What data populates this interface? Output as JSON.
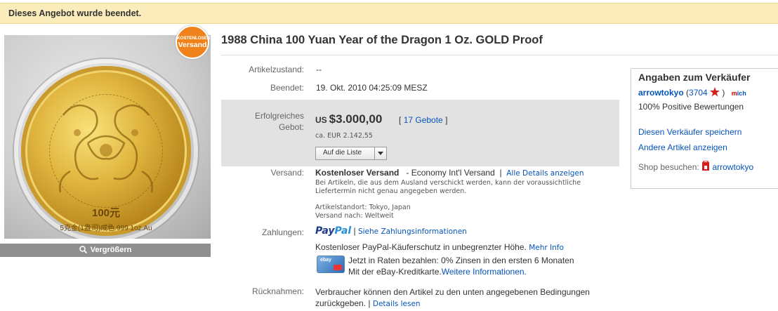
{
  "banner": "Dieses Angebot wurde beendet.",
  "badge": {
    "line1": "KOSTENLOSER",
    "line2": "Versand"
  },
  "coin": {
    "value": "100元",
    "rim": "5克金(1盎司)成色.999 1oz.Au"
  },
  "enlarge_label": "Vergrößern",
  "title": "1988 China 100 Yuan Year of the Dragon 1 Oz. GOLD Proof",
  "condition": {
    "label": "Artikelzustand:",
    "value": "--"
  },
  "ended": {
    "label": "Beendet:",
    "value": "19. Okt. 2010 04:25:09 MESZ"
  },
  "bid": {
    "label_line1": "Erfolgreiches",
    "label_line2": "Gebot:",
    "currency": "US",
    "amount": "$3.000,00",
    "bids_open": "[",
    "bids_link": "17 Gebote",
    "bids_close": "]",
    "converted": "ca. EUR 2.142,55",
    "watch_button": "Auf die Liste"
  },
  "shipping": {
    "label": "Versand:",
    "free": "Kostenloser Versand",
    "method": "- Economy Int'l Versand",
    "sep": "|",
    "details_link": "Alle Details anzeigen",
    "note_line1": "Bei Artikeln, die aus dem Ausland verschickt werden, kann der voraussichtliche",
    "note_line2": "Liefertermin nicht genau angegeben werden.",
    "location": "Artikelstandort: Tokyo, Japan",
    "ships_to": "Versand nach: Weltweit"
  },
  "payment": {
    "label": "Zahlungen:",
    "paypal1": "Pay",
    "paypal2": "Pal",
    "sep": "|",
    "info_link": "Siehe Zahlungsinformationen",
    "protection": "Kostenloser PayPal-Käuferschutz in unbegrenzter Höhe.",
    "more_link": "Mehr Info",
    "rates_line1": "Jetzt in Raten bezahlen: 0% Zinsen in den ersten 6 Monaten",
    "rates_line2": "Mit der eBay-Kreditkarte.",
    "rates_link": "Weitere Informationen.",
    "card_label": "ebay"
  },
  "returns": {
    "label": "Rücknahmen:",
    "line1": "Verbraucher können den Artikel zu den unten angegebenen Bedingungen",
    "line2": "zurückgeben.",
    "sep": "|",
    "details_link": "Details lesen"
  },
  "seller": {
    "heading": "Angaben zum Verkäufer",
    "name": "arrowtokyo",
    "open": "(",
    "score": "3704",
    "close": ")",
    "me_label": "m",
    "me_label2": "ich",
    "positive": "100% Positive Bewertungen",
    "save_link": "Diesen Verkäufer speichern",
    "other_link": "Andere Artikel anzeigen",
    "shop_label": "Shop besuchen:",
    "shop_link": "arrowtokyo"
  },
  "colors": {
    "link": "#0654ba",
    "banner": "#fbedbb",
    "badge": "#f0821c"
  }
}
